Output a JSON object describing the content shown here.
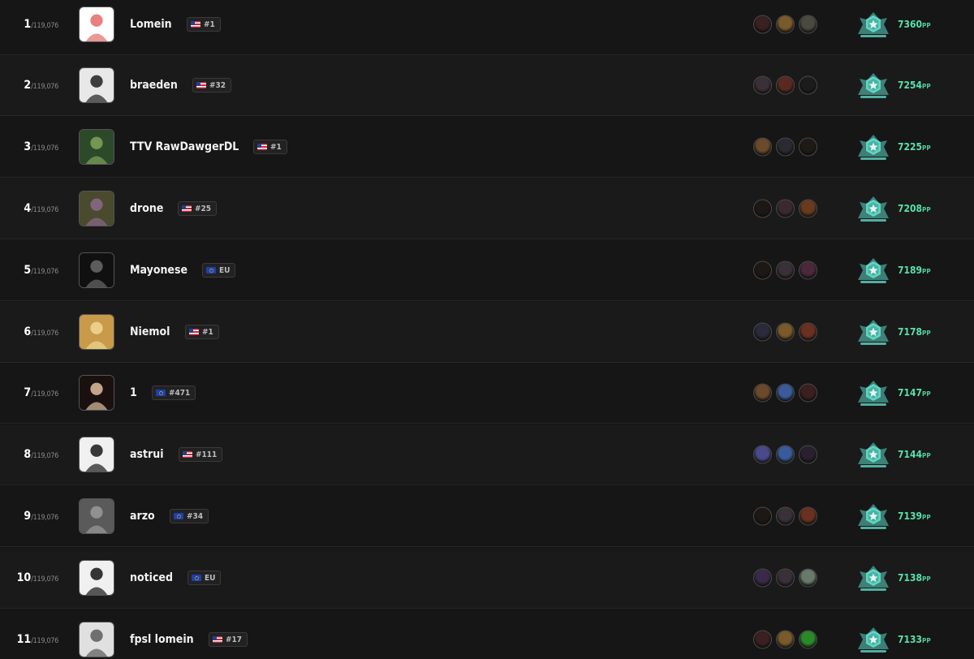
{
  "leaderboard": {
    "total_label": "/119,076",
    "pp_unit": "PP",
    "rows": [
      {
        "rank": "1",
        "name": "Lomein",
        "region": "#1",
        "flag": "us",
        "pp": "7360",
        "avatar_colors": [
          "#ffffff",
          "#e46a6a"
        ],
        "heroes": [
          {
            "icon": "hero-icon",
            "color": "#3a2020"
          },
          {
            "icon": "hero-icon",
            "color": "#7a5a2a"
          },
          {
            "icon": "hero-icon",
            "color": "#4a4a40"
          }
        ]
      },
      {
        "rank": "2",
        "name": "braeden",
        "region": "#32",
        "flag": "us",
        "pp": "7254",
        "avatar_colors": [
          "#e8e8e8",
          "#202020"
        ],
        "heroes": [
          {
            "icon": "hero-icon",
            "color": "#3a3038"
          },
          {
            "icon": "hero-icon",
            "color": "#5a2a22"
          },
          {
            "icon": "hero-icon",
            "color": "#1c1c1c"
          }
        ]
      },
      {
        "rank": "3",
        "name": "TTV RawDawgerDL",
        "region": "#1",
        "flag": "us",
        "pp": "7225",
        "avatar_colors": [
          "#2c4a2a",
          "#7fa45a"
        ],
        "heroes": [
          {
            "icon": "hero-icon",
            "color": "#6a4a2a"
          },
          {
            "icon": "hero-icon",
            "color": "#2a2a30"
          },
          {
            "icon": "hero-icon",
            "color": "#1e1a16"
          }
        ]
      },
      {
        "rank": "4",
        "name": "drone",
        "region": "#25",
        "flag": "us",
        "pp": "7208",
        "avatar_colors": [
          "#4a4a2e",
          "#8a6a8a"
        ],
        "heroes": [
          {
            "icon": "hero-icon",
            "color": "#1e1814"
          },
          {
            "icon": "hero-icon",
            "color": "#3a2a2e"
          },
          {
            "icon": "hero-icon",
            "color": "#6a3a1e"
          }
        ]
      },
      {
        "rank": "5",
        "name": "Mayonese",
        "region": "EU",
        "flag": "eu",
        "pp": "7189",
        "avatar_colors": [
          "#101010",
          "#6a6a6a"
        ],
        "heroes": [
          {
            "icon": "hero-icon",
            "color": "#1e1814"
          },
          {
            "icon": "hero-icon",
            "color": "#3a3038"
          },
          {
            "icon": "hero-icon",
            "color": "#4a2a3a"
          }
        ]
      },
      {
        "rank": "6",
        "name": "Niemol",
        "region": "#1",
        "flag": "us",
        "pp": "7178",
        "avatar_colors": [
          "#c89a4a",
          "#f0d890"
        ],
        "heroes": [
          {
            "icon": "hero-icon",
            "color": "#2a2a3a"
          },
          {
            "icon": "hero-icon",
            "color": "#7a5a2a"
          },
          {
            "icon": "hero-icon",
            "color": "#6a3020"
          }
        ]
      },
      {
        "rank": "7",
        "name": "1",
        "region": "#471",
        "flag": "eu",
        "pp": "7147",
        "avatar_colors": [
          "#1a1010",
          "#e0c0a0"
        ],
        "heroes": [
          {
            "icon": "hero-icon",
            "color": "#6a4a2a"
          },
          {
            "icon": "hero-icon",
            "color": "#3a5a9a"
          },
          {
            "icon": "hero-icon",
            "color": "#3a2020"
          }
        ]
      },
      {
        "rank": "8",
        "name": "astrui",
        "region": "#111",
        "flag": "us",
        "pp": "7144",
        "avatar_colors": [
          "#f0f0f0",
          "#181818"
        ],
        "heroes": [
          {
            "icon": "hero-icon",
            "color": "#4a4a8a"
          },
          {
            "icon": "hero-icon",
            "color": "#3a5a9a"
          },
          {
            "icon": "hero-icon",
            "color": "#2a2030"
          }
        ]
      },
      {
        "rank": "9",
        "name": "arzo",
        "region": "#34",
        "flag": "eu",
        "pp": "7139",
        "avatar_colors": [
          "#5a5a5a",
          "#9a9a9a"
        ],
        "heroes": [
          {
            "icon": "hero-icon",
            "color": "#1e1814"
          },
          {
            "icon": "hero-icon",
            "color": "#3a3038"
          },
          {
            "icon": "hero-icon",
            "color": "#6a3020"
          }
        ]
      },
      {
        "rank": "10",
        "name": "noticed",
        "region": "EU",
        "flag": "eu",
        "pp": "7138",
        "avatar_colors": [
          "#f0f0f0",
          "#141414"
        ],
        "heroes": [
          {
            "icon": "hero-icon",
            "color": "#3a2a4a"
          },
          {
            "icon": "hero-icon",
            "color": "#3a3038"
          },
          {
            "icon": "hero-icon",
            "color": "#6a7a6a"
          }
        ]
      },
      {
        "rank": "11",
        "name": "fpsl lomein",
        "region": "#17",
        "flag": "us",
        "pp": "7133",
        "avatar_colors": [
          "#e0e0e0",
          "#5a5a5a"
        ],
        "heroes": [
          {
            "icon": "hero-icon",
            "color": "#3a2020"
          },
          {
            "icon": "hero-icon",
            "color": "#7a5a2a"
          },
          {
            "icon": "hero-icon",
            "color": "#2a8a2a"
          }
        ]
      }
    ]
  },
  "colors": {
    "pp": "#58e0a9",
    "emblem": "#5fd6c4"
  }
}
